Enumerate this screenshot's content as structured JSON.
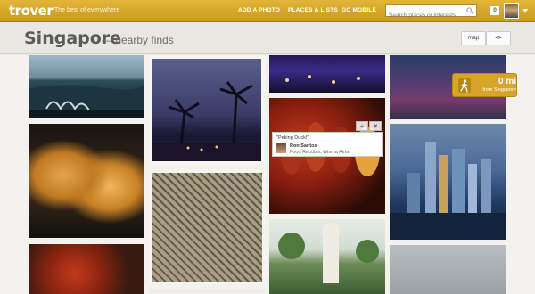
{
  "header": {
    "logo": "trover",
    "tagline": "The best of everywhere",
    "nav": [
      "ADD A PHOTO",
      "PLACES & LISTS",
      "GO MOBILE"
    ],
    "search_placeholder": "Search places or interests",
    "notification_count": "0"
  },
  "page": {
    "title": "Singapore",
    "subtitle": "— nearby finds",
    "map_button": "map",
    "embed_button": "<>"
  },
  "photo_card": {
    "quote": "\"Peking Duck!\"",
    "author": "Ron Santos",
    "place": "Food Republic Wisma Atria"
  },
  "distance": {
    "value": "0 mi",
    "label": "from Singapore"
  },
  "colors": {
    "brand": "#d4a52a",
    "header_bg": "#e9e7e1",
    "content_bg": "#f4f2ee"
  },
  "icons": {
    "search": "magnifier",
    "walk": "walking-person",
    "add": "plus",
    "like": "heart",
    "menu": "chevron-down"
  }
}
